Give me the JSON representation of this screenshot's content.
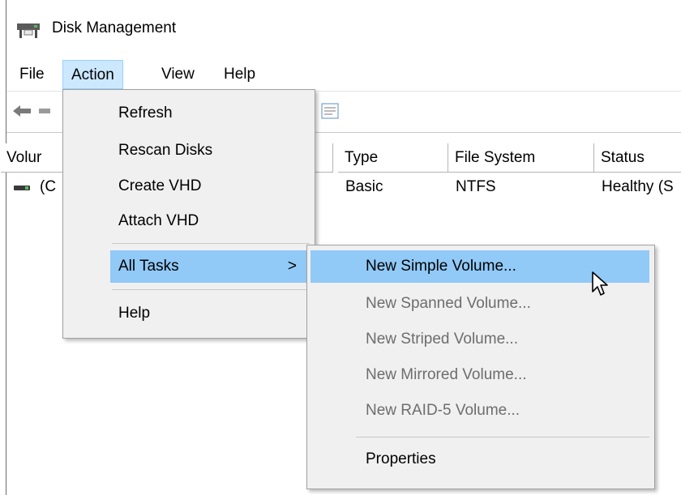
{
  "window": {
    "title": "Disk Management"
  },
  "menubar": [
    "File",
    "Action",
    "View",
    "Help"
  ],
  "table": {
    "headers": [
      "Volur",
      "Type",
      "File System",
      "Status"
    ],
    "rows": [
      {
        "volume": "(C",
        "type": "Basic",
        "filesystem": "NTFS",
        "status": "Healthy (S"
      }
    ]
  },
  "action_menu": {
    "items": [
      "Refresh",
      "Rescan Disks",
      "Create VHD",
      "Attach VHD",
      "All Tasks",
      "Help"
    ],
    "submenu_arrow": ">"
  },
  "all_tasks_submenu": {
    "items": [
      {
        "label": "New Simple Volume...",
        "enabled": true,
        "highlighted": true
      },
      {
        "label": "New Spanned Volume...",
        "enabled": false
      },
      {
        "label": "New Striped Volume...",
        "enabled": false
      },
      {
        "label": "New Mirrored Volume...",
        "enabled": false
      },
      {
        "label": "New RAID-5 Volume...",
        "enabled": false
      },
      {
        "label": "Properties",
        "enabled": true
      }
    ]
  },
  "colors": {
    "highlight": "#91c9f7",
    "menu_bg": "#f0f0f0",
    "active_menu_bg": "#cce8ff",
    "disabled_text": "#6d6d6d"
  },
  "icons": [
    "disk-management-app-icon",
    "back-arrow-icon",
    "forward-arrow-icon",
    "properties-icon",
    "disk-icon",
    "mouse-pointer-icon"
  ]
}
